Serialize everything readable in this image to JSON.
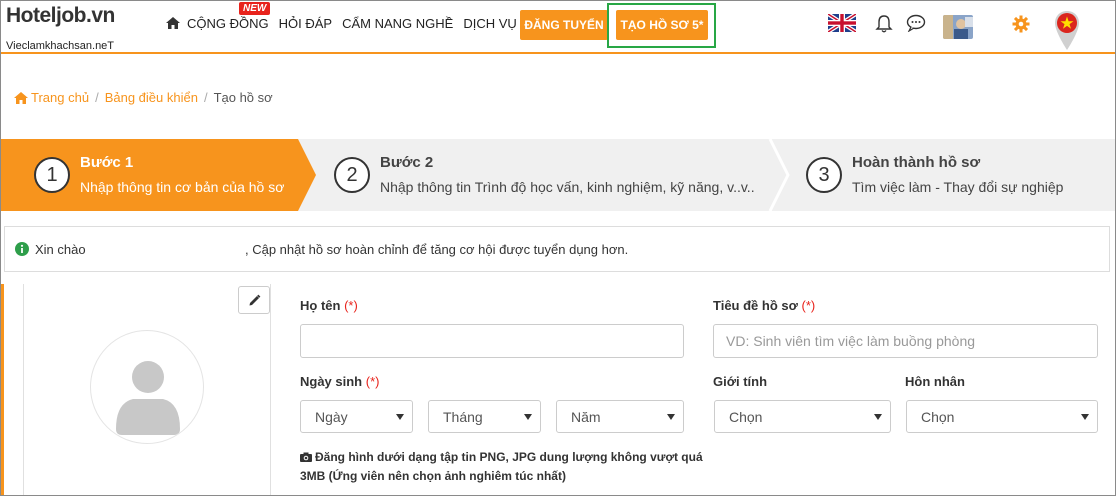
{
  "header": {
    "logo_text_a": "Hotel",
    "logo_text_b": "job.vn",
    "logo_subtitle": "Vieclamkhachsan.neT",
    "nav": [
      {
        "label": "Cộng đồng",
        "badge": "New"
      },
      {
        "label": "Hỏi đáp"
      },
      {
        "label": "Cẩm nang nghề"
      },
      {
        "label": "Dịch vụ"
      }
    ],
    "post_job_button": "ĐĂNG TUYỂN",
    "create_profile_button": "TẠO HỒ SƠ 5*"
  },
  "breadcrumb": {
    "home": "Trang chủ",
    "dashboard": "Bảng điều khiển",
    "current": "Tạo hồ sơ"
  },
  "steps": [
    {
      "number": "1",
      "title": "Bước 1",
      "desc": "Nhập thông tin cơ bản của hồ sơ"
    },
    {
      "number": "2",
      "title": "Bước 2",
      "desc": "Nhập thông tin Trình độ học vấn, kinh nghiệm, kỹ năng, v..v.."
    },
    {
      "number": "3",
      "title": "Hoàn thành hồ sơ",
      "desc": "Tìm việc làm - Thay đổi sự nghiệp"
    }
  ],
  "notice": {
    "greeting": "Xin chào",
    "message": ", Cập nhật hồ sơ hoàn chỉnh để tăng cơ hội được tuyển dụng hơn."
  },
  "form": {
    "fullname_label": "Họ tên",
    "required_mark": "(*)",
    "fullname_value": "",
    "title_label": "Tiêu đề hồ sơ",
    "title_placeholder": "VD: Sinh viên tìm việc làm buồng phòng",
    "dob_label": "Ngày sinh",
    "day_select": "Ngày",
    "month_select": "Tháng",
    "year_select": "Năm",
    "gender_label": "Giới tính",
    "gender_select": "Chọn",
    "marital_label": "Hôn nhân",
    "marital_select": "Chọn",
    "photo_hint": "Đăng hình dưới dạng tập tin PNG, JPG dung lượng không vượt quá 3MB (Ứng viên nên chọn ảnh nghiêm túc nhất)"
  },
  "colors": {
    "accent": "#f7941d",
    "required": "#e8231c",
    "highlight": "#28a745"
  }
}
